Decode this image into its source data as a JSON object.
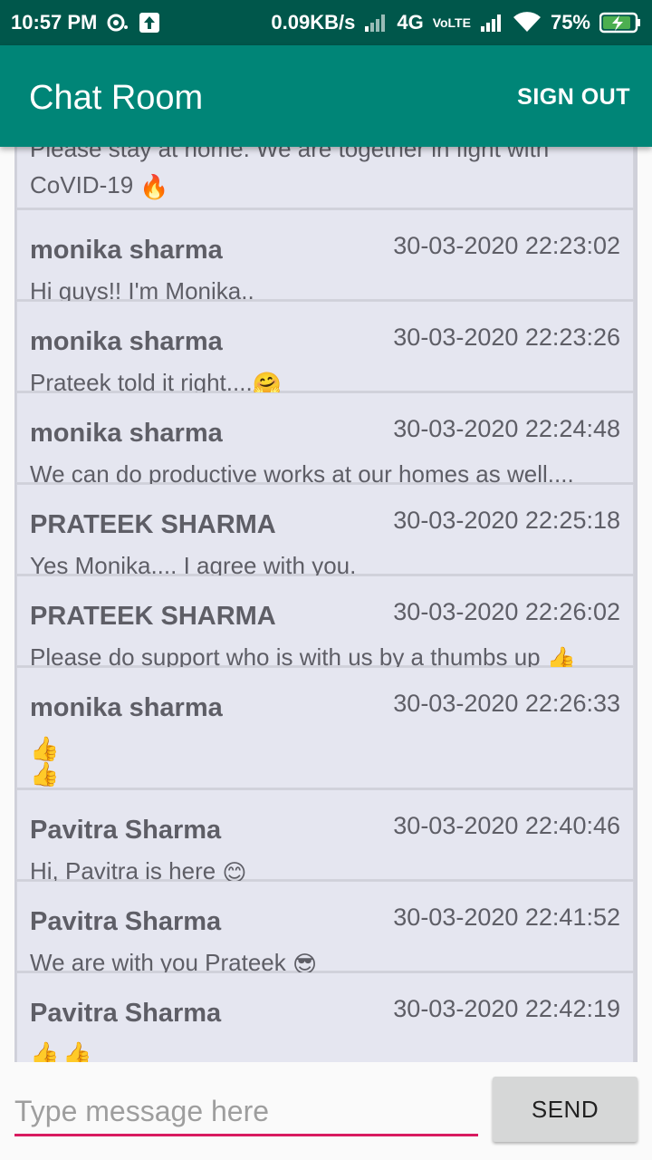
{
  "status_bar": {
    "time": "10:57 PM",
    "speed": "0.09KB/s",
    "network": "4G",
    "volte_top": "Vo",
    "volte_bottom": "LTE",
    "battery": "75%"
  },
  "app_bar": {
    "title": "Chat Room",
    "sign_out_label": "SIGN OUT"
  },
  "partial_message": {
    "line1": "Please stay at home. We are together in fight with",
    "line2": "CoVID-19",
    "emoji": "🔥"
  },
  "messages": [
    {
      "name": "monika sharma",
      "time": "30-03-2020 22:23:02",
      "text": "Hi guys!! I'm Monika.."
    },
    {
      "name": "monika sharma",
      "time": "30-03-2020 22:23:26",
      "text": "Prateek told it right....",
      "emoji": "🤗"
    },
    {
      "name": "monika sharma",
      "time": "30-03-2020 22:24:48",
      "text": "We can do productive works at our homes as well...."
    },
    {
      "name": "PRATEEK SHARMA",
      "time": "30-03-2020 22:25:18",
      "text": "Yes Monika.... I agree with you."
    },
    {
      "name": "PRATEEK SHARMA",
      "time": "30-03-2020 22:26:02",
      "text": "Please do support who is with us by a thumbs up",
      "emoji": "👍"
    },
    {
      "name": "monika sharma",
      "time": "30-03-2020 22:26:33",
      "emoji_lines": [
        "👍",
        "👍"
      ]
    },
    {
      "name": "Pavitra Sharma",
      "time": "30-03-2020 22:40:46",
      "text": "Hi, Pavitra is here",
      "emoji": "😊"
    },
    {
      "name": "Pavitra Sharma",
      "time": "30-03-2020 22:41:52",
      "text": "We are with you Prateek",
      "emoji": "😎"
    },
    {
      "name": "Pavitra Sharma",
      "time": "30-03-2020 22:42:19",
      "emoji_row": [
        "👍",
        "👍"
      ]
    }
  ],
  "input": {
    "placeholder": "Type message here",
    "value": ""
  },
  "send_label": "SEND",
  "colors": {
    "status_bar": "#00574b",
    "app_bar": "#008577",
    "accent": "#d81b60",
    "message_bg": "#e5e6f0"
  }
}
